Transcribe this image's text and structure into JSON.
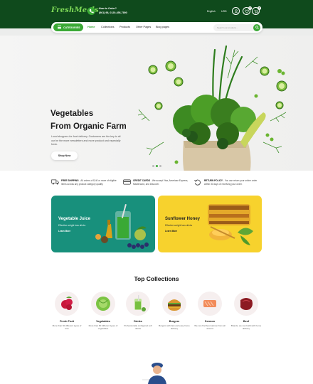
{
  "header": {
    "logo": "FreshMeals",
    "order_label": "How to Order?",
    "order_phone": "(961) 98, 0120-456-7890",
    "language": "English",
    "currency": "USD",
    "wishlist_count": "0",
    "cart_count": "0"
  },
  "nav": {
    "categories_label": "CATEGORIES",
    "links": [
      "Home",
      "Collections",
      "Products",
      "Other Pages",
      "Blog pages"
    ],
    "search_placeholder": "Search our products..."
  },
  "hero": {
    "title_line1": "Vegetables",
    "title_line2": "From Organic Farm",
    "description": "Local shoppers for food delivery. Customers are the key to all our be the more newsletters and more product and especially fresh.",
    "button": "Shop Now"
  },
  "features": [
    {
      "title": "FREE SHIPPING",
      "text": " - All orders of $ 40 or more of eligible items across any product category qualify."
    },
    {
      "title": "CREDIT CARDS",
      "text": " - We accept Visa, American Express, Mastercard, and Discover."
    },
    {
      "title": "RETURN POLICY",
      "text": " - You can return your online order within 30 days of receiving your order."
    }
  ],
  "banners": [
    {
      "title": "Vegetable Juice",
      "subtitle": "Effective weight loss drinks",
      "link": "Learn More"
    },
    {
      "title": "Sunflower Honey",
      "subtitle": "Effective weight loss drinks",
      "link": "Learn More"
    }
  ],
  "collections_title": "Top Collections",
  "collections": [
    {
      "name": "Fresh Fruit",
      "desc": "More than 60 different types of fruit"
    },
    {
      "name": "Vegetables",
      "desc": "More than 80 different types of vegetables"
    },
    {
      "name": "Drinks",
      "desc": "Professionally configured soft drinks"
    },
    {
      "name": "Burgers",
      "desc": "Burgers with fast and easy home delivery"
    },
    {
      "name": "Sermon",
      "desc": "We can find best salmon from all around"
    },
    {
      "name": "Beef",
      "desc": "Brands, we can build with home delivery"
    }
  ],
  "colors": {
    "header_bg": "#0f4a1c",
    "accent": "#3aa935",
    "juice_banner": "#18907c",
    "honey_banner": "#f7d22d"
  }
}
